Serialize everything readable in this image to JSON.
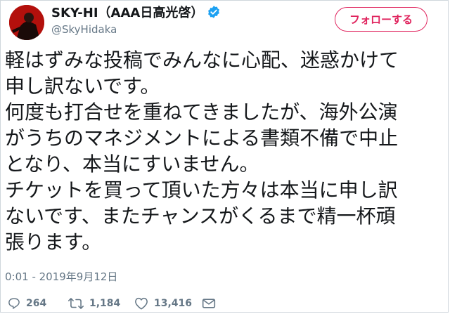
{
  "user": {
    "display_name": "SKY-HI（AAA日高光啓）",
    "handle": "@SkyHidaka"
  },
  "follow_button": {
    "label": "フォローする"
  },
  "tweet": {
    "lines": [
      "軽はずみな投稿でみんなに心配、迷惑かけて",
      "申し訳ないです。",
      "何度も打合せを重ねてきましたが、海外公演",
      "がうちのマネジメントによる書類不備で中止",
      "となり、本当にすいません。",
      "チケットを買って頂いた方々は本当に申し訳",
      "ないです、またチャンスがくるまで精一杯頑",
      "張ります。"
    ],
    "timestamp": "0:01 - 2019年9月12日"
  },
  "actions": {
    "replies": "264",
    "retweets": "1,184",
    "likes": "13,416"
  },
  "icons": {
    "verified": "verified-badge-icon",
    "reply": "reply-icon",
    "retweet": "retweet-icon",
    "like": "heart-icon",
    "message": "envelope-icon"
  },
  "colors": {
    "follow_accent": "#e0245e",
    "verified": "#1da1f2",
    "muted": "#657786"
  }
}
